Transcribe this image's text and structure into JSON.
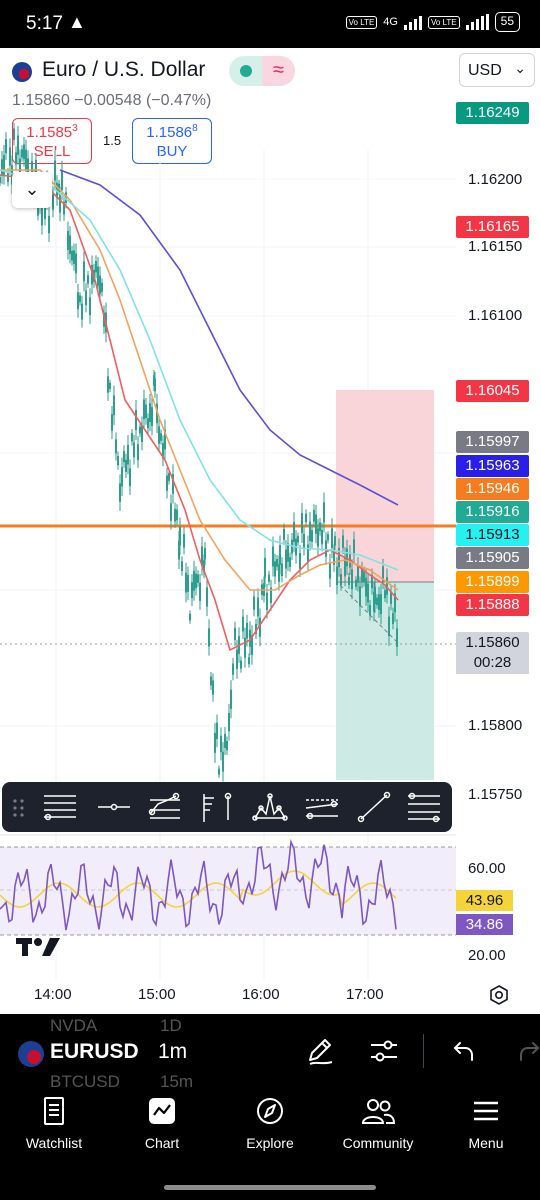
{
  "status_bar": {
    "time": "5:17",
    "network_label": "4G",
    "volte_1": "Vo LTE",
    "volte_2": "Vo LTE",
    "battery": "55"
  },
  "header": {
    "symbol_name": "Euro / U.S. Dollar",
    "currency": "USD",
    "last_price": "1.15860",
    "change": "−0.00548",
    "change_pct": "(−0.47%)",
    "sell_price": "1.1585",
    "sell_price_sup": "3",
    "sell_label": "SELL",
    "buy_price": "1.1586",
    "buy_price_sup": "8",
    "buy_label": "BUY",
    "spread": "1.5"
  },
  "chart": {
    "price_axis": [
      "1.16200",
      "1.16150",
      "1.16100",
      "1.15800",
      "1.15750"
    ],
    "price_tags": [
      {
        "text": "1.16249",
        "color": "#089981"
      },
      {
        "text": "1.16165",
        "color": "#f23645"
      },
      {
        "text": "1.16045",
        "color": "#f23645"
      },
      {
        "text": "1.15997",
        "color": "#787b86"
      },
      {
        "text": "1.15963",
        "color": "#2a1fe8"
      },
      {
        "text": "1.15946",
        "color": "#f57c1f"
      },
      {
        "text": "1.15916",
        "color": "#22ab94"
      },
      {
        "text": "1.15913",
        "color": "#26f0f0",
        "text_color": "#131722"
      },
      {
        "text": "1.15905",
        "color": "#787b86"
      },
      {
        "text": "1.15899",
        "color": "#ff9800"
      },
      {
        "text": "1.15888",
        "color": "#f23645"
      },
      {
        "text": "1.15860",
        "color": "#d1d4dc",
        "text_color": "#131722"
      }
    ],
    "countdown": "00:28",
    "time_axis": [
      "14:00",
      "15:00",
      "16:00",
      "17:00"
    ],
    "colors": {
      "candle": "#2e9e8f",
      "ma_red": "#f05f5f",
      "ma_orange": "#f5a25d",
      "ma_cyan": "#7fe3e3",
      "ma_blue": "#5b4fd6",
      "horizontal_line": "#f57c1f",
      "stop_zone": "#f9d5d9",
      "target_zone": "#cdebe4"
    }
  },
  "rsi": {
    "axis": [
      "60.00",
      "20.00"
    ],
    "ma_value": "43.96",
    "rsi_value": "34.86",
    "ma_color": "#f5d33b",
    "rsi_color": "#7e57c2"
  },
  "drawing_toolbar": {
    "tools": [
      "horizontal-lines-tool",
      "horizontal-ray-tool",
      "path-tool",
      "long-position-tool",
      "pattern-tool",
      "channel-tool",
      "trend-line-tool",
      "fib-retracement-tool"
    ]
  },
  "bottom_bar": {
    "symbol": "EURUSD",
    "interval": "1m",
    "ghost_rows": [
      {
        "symbol": "NVDA",
        "interval": "1D"
      },
      {
        "symbol": "BTCUSD",
        "interval": "15m"
      }
    ]
  },
  "nav": {
    "items": [
      {
        "label": "Watchlist",
        "icon": "watchlist-icon"
      },
      {
        "label": "Chart",
        "icon": "chart-icon"
      },
      {
        "label": "Explore",
        "icon": "compass-icon"
      },
      {
        "label": "Community",
        "icon": "community-icon"
      },
      {
        "label": "Menu",
        "icon": "hamburger-icon"
      }
    ]
  }
}
